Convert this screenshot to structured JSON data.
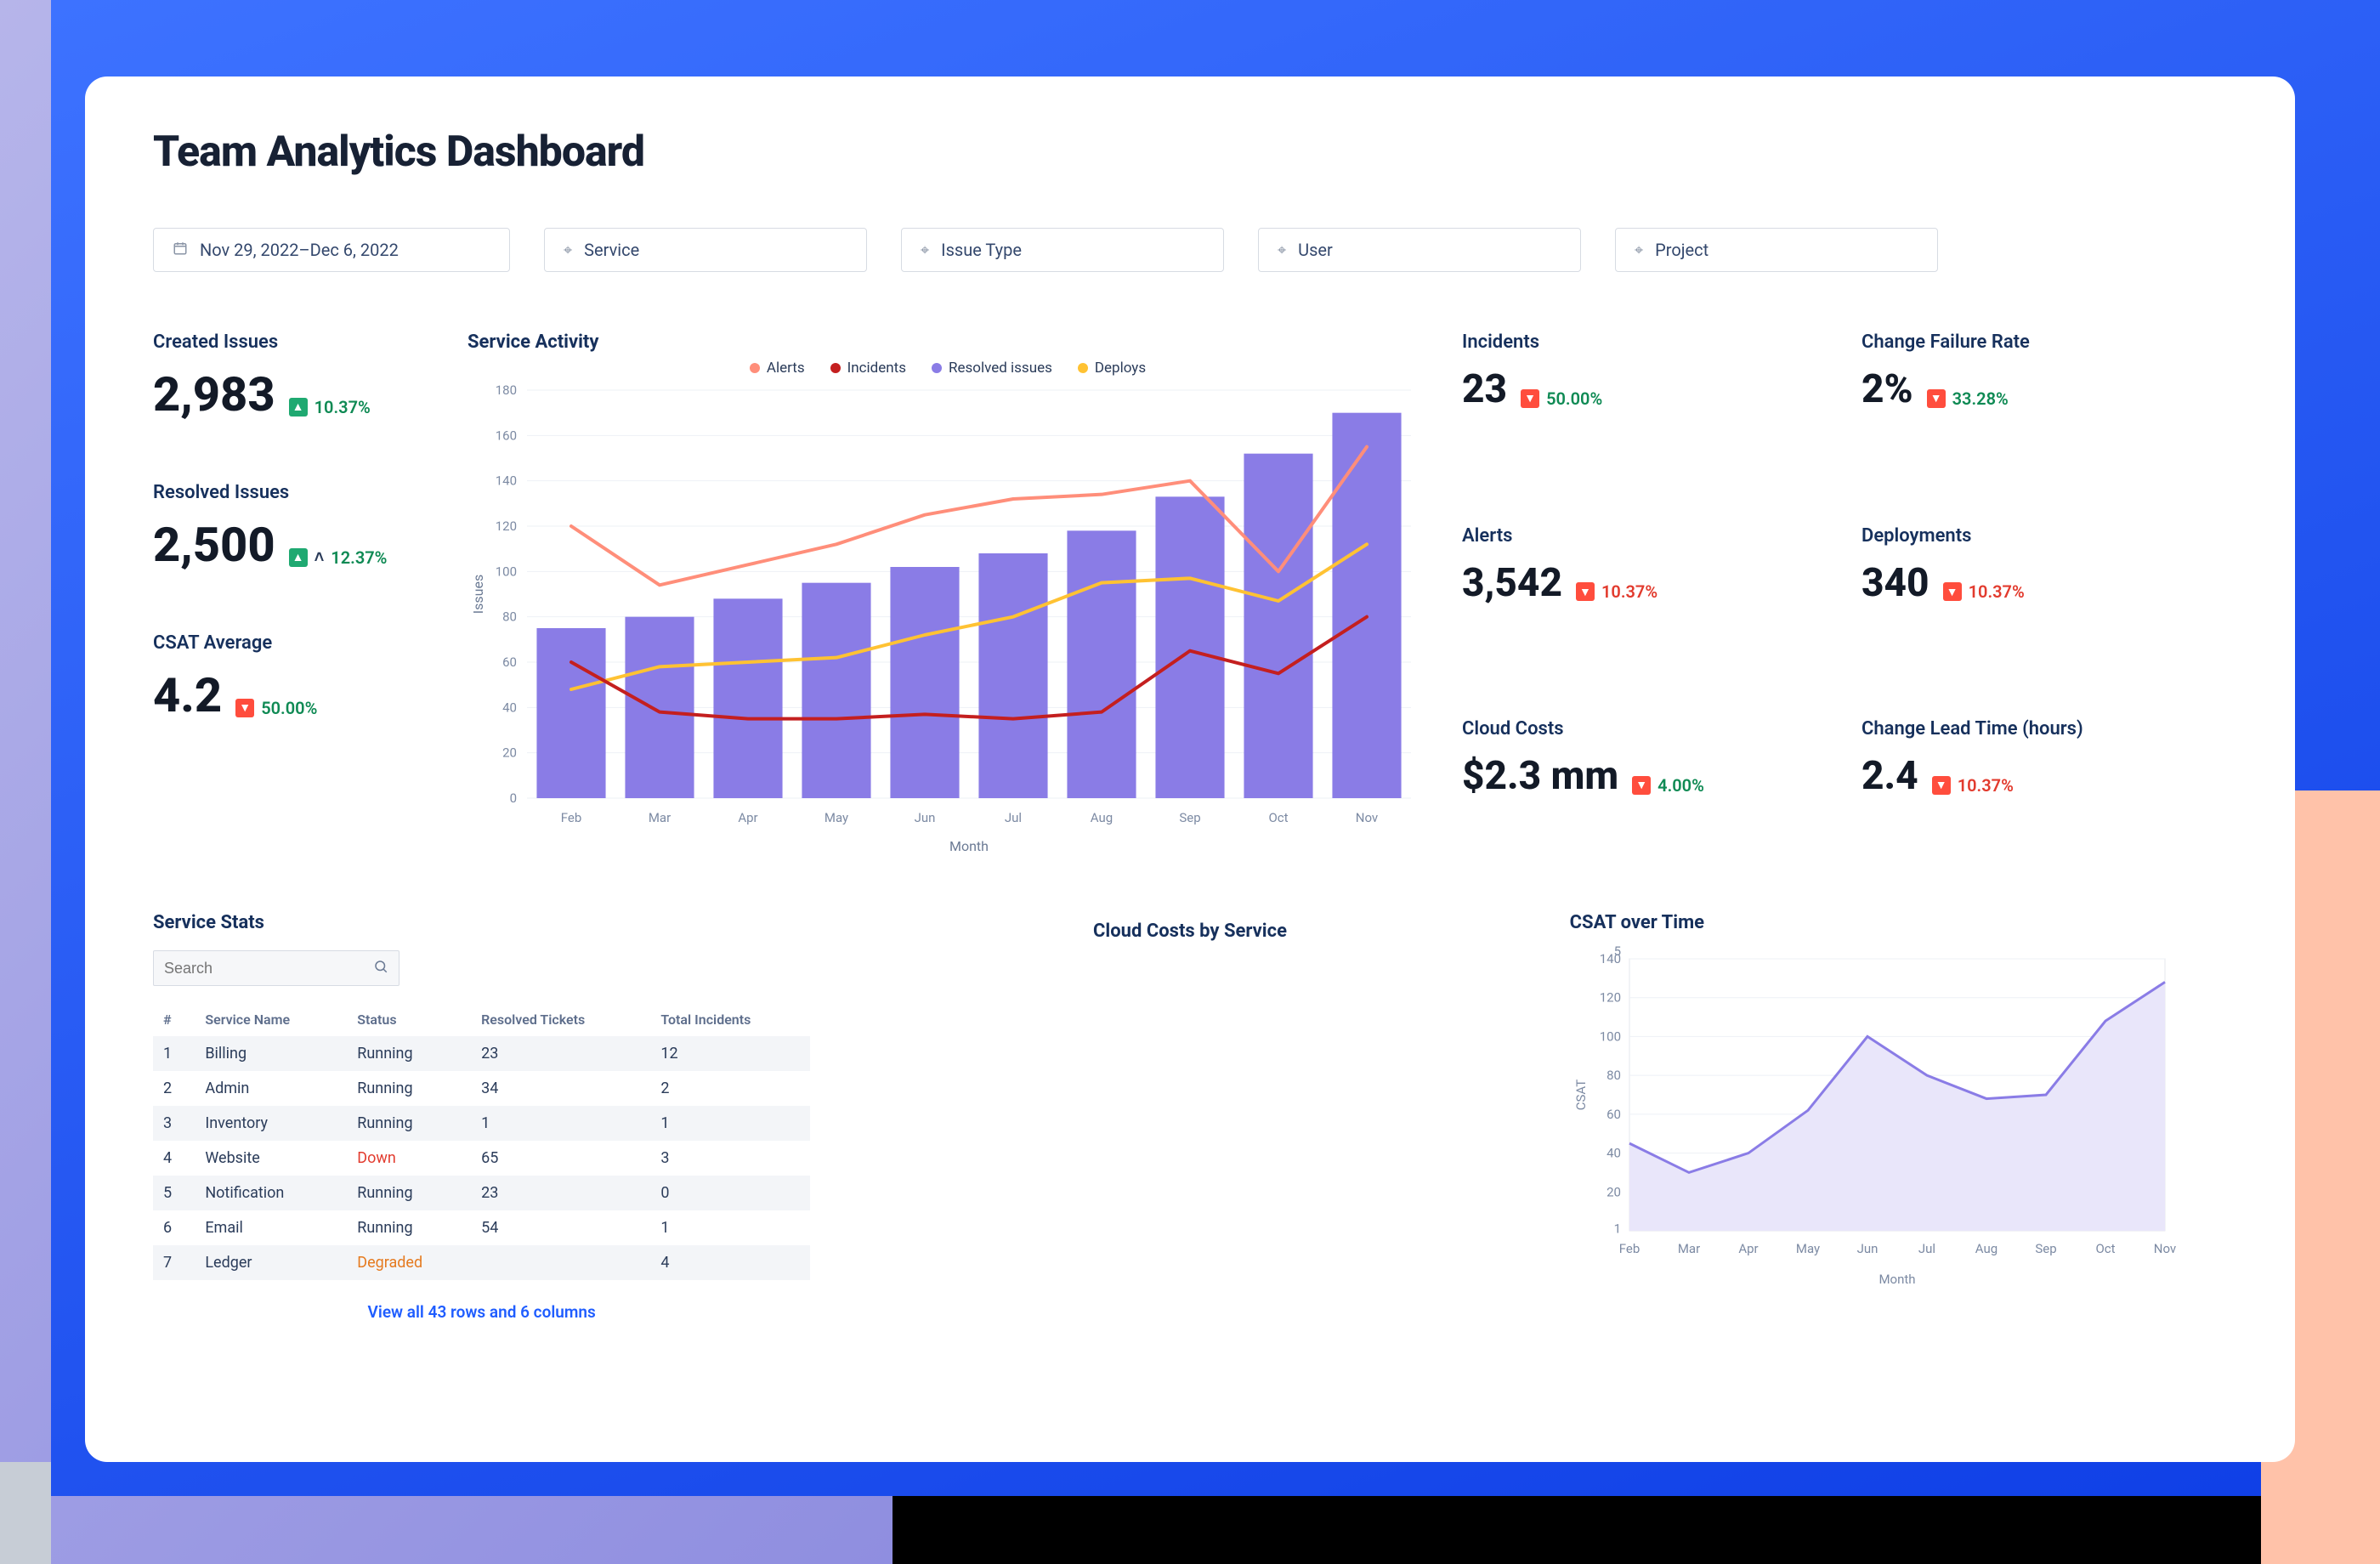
{
  "title": "Team Analytics Dashboard",
  "filters": {
    "date": "Nov 29, 2022–Dec 6, 2022",
    "service": "Service",
    "issue_type": "Issue Type",
    "user": "User",
    "project": "Project"
  },
  "left_metrics": {
    "created": {
      "label": "Created Issues",
      "value": "2,983",
      "delta": "10.37%",
      "dir": "up",
      "color": "green"
    },
    "resolved": {
      "label": "Resolved Issues",
      "value": "2,500",
      "delta": "12.37%",
      "dir": "up",
      "color": "green",
      "caret": true
    },
    "csat": {
      "label": "CSAT Average",
      "value": "4.2",
      "delta": "50.00%",
      "dir": "down",
      "color": "green"
    }
  },
  "right_metrics": {
    "incidents": {
      "label": "Incidents",
      "value": "23",
      "delta": "50.00%",
      "dir": "down",
      "color": "green"
    },
    "cfr": {
      "label": "Change Failure Rate",
      "value": "2%",
      "delta": "33.28%",
      "dir": "down",
      "color": "green"
    },
    "alerts": {
      "label": "Alerts",
      "value": "3,542",
      "delta": "10.37%",
      "dir": "down",
      "color": "red"
    },
    "deploys": {
      "label": "Deployments",
      "value": "340",
      "delta": "10.37%",
      "dir": "down",
      "color": "red"
    },
    "cloud": {
      "label": "Cloud Costs",
      "value": "$2.3 mm",
      "delta": "4.00%",
      "dir": "down",
      "color": "green"
    },
    "clt": {
      "label": "Change Lead Time (hours)",
      "value": "2.4",
      "delta": "10.37%",
      "dir": "down",
      "color": "red"
    }
  },
  "service_activity": {
    "title": "Service Activity",
    "legend": {
      "alerts": "Alerts",
      "incidents": "Incidents",
      "resolved": "Resolved issues",
      "deploys": "Deploys"
    },
    "xlabel": "Month",
    "ylabel": "Issues"
  },
  "chart_data": [
    {
      "id": "service_activity",
      "type": "bar+line",
      "xlabel": "Month",
      "ylabel": "Issues",
      "ylim": [
        0,
        180
      ],
      "yticks": [
        0,
        20,
        40,
        60,
        80,
        100,
        120,
        140,
        160,
        180
      ],
      "categories": [
        "Feb",
        "Mar",
        "Apr",
        "May",
        "Jun",
        "Jul",
        "Aug",
        "Sep",
        "Oct",
        "Nov"
      ],
      "series": [
        {
          "name": "Resolved issues",
          "kind": "bar",
          "color": "#8a7ce6",
          "values": [
            75,
            80,
            88,
            95,
            102,
            108,
            118,
            133,
            152,
            170
          ]
        },
        {
          "name": "Alerts",
          "kind": "line",
          "color": "#ff8e7a",
          "values": [
            120,
            94,
            103,
            112,
            125,
            132,
            134,
            140,
            100,
            155
          ]
        },
        {
          "name": "Deploys",
          "kind": "line",
          "color": "#ffc233",
          "values": [
            48,
            58,
            60,
            62,
            72,
            80,
            95,
            97,
            87,
            112
          ]
        },
        {
          "name": "Incidents",
          "kind": "line",
          "color": "#c41f1f",
          "values": [
            60,
            38,
            35,
            35,
            37,
            35,
            38,
            65,
            55,
            80
          ]
        }
      ]
    },
    {
      "id": "csat_over_time",
      "type": "area",
      "title": "CSAT over Time",
      "xlabel": "Month",
      "ylabel": "CSAT",
      "ylim": [
        1,
        140
      ],
      "yticks": [
        1,
        20,
        40,
        60,
        80,
        100,
        120,
        140,
        5
      ],
      "yticks_display": [
        "1",
        "20",
        "40",
        "60",
        "80",
        "100",
        "120",
        "140",
        "5"
      ],
      "categories": [
        "Feb",
        "Mar",
        "Apr",
        "May",
        "Jun",
        "Jul",
        "Aug",
        "Sep",
        "Oct",
        "Nov"
      ],
      "values": [
        45,
        30,
        40,
        62,
        100,
        80,
        68,
        70,
        108,
        128
      ],
      "color": "#8a7ce6",
      "fill": "#e9e6fa"
    }
  ],
  "cloud_costs_title": "Cloud Costs by Service",
  "csat_title": "CSAT over Time",
  "service_stats": {
    "title": "Service Stats",
    "search_placeholder": "Search",
    "columns": [
      "#",
      "Service Name",
      "Status",
      "Resolved Tickets",
      "Total Incidents"
    ],
    "rows": [
      {
        "n": "1",
        "name": "Billing",
        "status": "Running",
        "resolved": "23",
        "incidents": "12"
      },
      {
        "n": "2",
        "name": "Admin",
        "status": "Running",
        "resolved": "34",
        "incidents": "2"
      },
      {
        "n": "3",
        "name": "Inventory",
        "status": "Running",
        "resolved": "1",
        "incidents": "1"
      },
      {
        "n": "4",
        "name": "Website",
        "status": "Down",
        "resolved": "65",
        "incidents": "3"
      },
      {
        "n": "5",
        "name": "Notification",
        "status": "Running",
        "resolved": "23",
        "incidents": "0"
      },
      {
        "n": "6",
        "name": "Email",
        "status": "Running",
        "resolved": "54",
        "incidents": "1"
      },
      {
        "n": "7",
        "name": "Ledger",
        "status": "Degraded",
        "resolved": "",
        "incidents": "4"
      }
    ],
    "view_all": "View all 43 rows and 6 columns"
  },
  "colors": {
    "bar": "#8a7ce6",
    "alerts": "#ff8e7a",
    "incidents": "#c41f1f",
    "deploys": "#ffc233"
  }
}
